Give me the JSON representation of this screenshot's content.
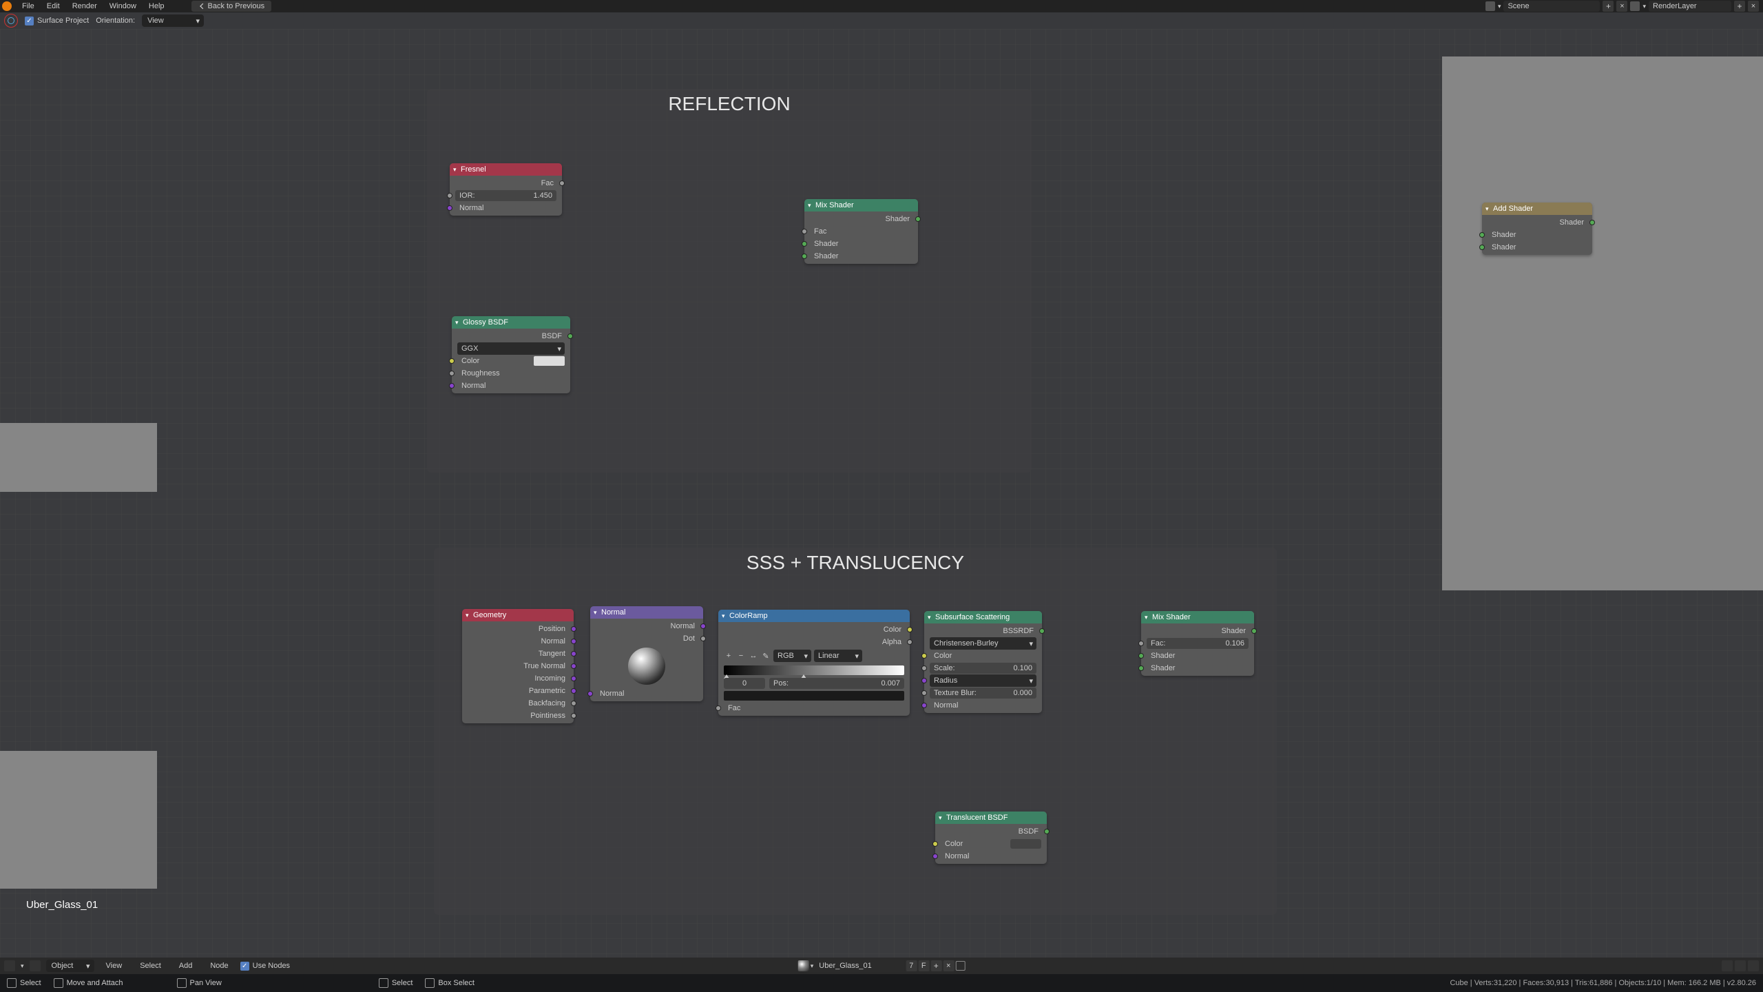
{
  "menu": {
    "file": "File",
    "edit": "Edit",
    "render": "Render",
    "window": "Window",
    "help": "Help",
    "back": "Back to Previous"
  },
  "header": {
    "scene": "Scene",
    "layer": "RenderLayer"
  },
  "subheader": {
    "surface_project": "Surface Project",
    "orientation": "Orientation:",
    "mode": "View"
  },
  "frames": {
    "reflection": "REFLECTION",
    "sss": "SSS + TRANSLUCENCY"
  },
  "nodes": {
    "fresnel": {
      "title": "Fresnel",
      "fac": "Fac",
      "ior_lbl": "IOR:",
      "ior_val": "1.450",
      "normal": "Normal"
    },
    "glossy": {
      "title": "Glossy BSDF",
      "bsdf": "BSDF",
      "dist": "GGX",
      "color": "Color",
      "rough": "Roughness",
      "normal": "Normal"
    },
    "mix1": {
      "title": "Mix Shader",
      "shader_out": "Shader",
      "fac": "Fac",
      "s1": "Shader",
      "s2": "Shader"
    },
    "addshader": {
      "title": "Add Shader",
      "shader_out": "Shader",
      "s1": "Shader",
      "s2": "Shader"
    },
    "geometry": {
      "title": "Geometry",
      "position": "Position",
      "normal": "Normal",
      "tangent": "Tangent",
      "true_normal": "True Normal",
      "incoming": "Incoming",
      "parametric": "Parametric",
      "backfacing": "Backfacing",
      "pointiness": "Pointiness"
    },
    "normalnode": {
      "title": "Normal",
      "normal_out": "Normal",
      "dot": "Dot",
      "normal_in": "Normal"
    },
    "colorramp": {
      "title": "ColorRamp",
      "color": "Color",
      "alpha": "Alpha",
      "mode1": "RGB",
      "mode2": "Linear",
      "pos_lbl": "Pos:",
      "pos_val": "0.007",
      "idx": "0",
      "fac": "Fac"
    },
    "sss": {
      "title": "Subsurface Scattering",
      "out": "BSSRDF",
      "method": "Christensen-Burley",
      "color": "Color",
      "scale_l": "Scale:",
      "scale_v": "0.100",
      "radius": "Radius",
      "blur_l": "Texture Blur:",
      "blur_v": "0.000",
      "normal": "Normal"
    },
    "mix2": {
      "title": "Mix Shader",
      "shader_out": "Shader",
      "fac_l": "Fac:",
      "fac_v": "0.106",
      "s1": "Shader",
      "s2": "Shader"
    },
    "translucent": {
      "title": "Translucent BSDF",
      "out": "BSDF",
      "color": "Color",
      "normal": "Normal"
    }
  },
  "material_label": "Uber_Glass_01",
  "bottombar": {
    "mode": "Object",
    "view": "View",
    "select": "Select",
    "add": "Add",
    "node": "Node",
    "use_nodes": "Use Nodes",
    "material": "Uber_Glass_01",
    "users": "7",
    "fake": "F"
  },
  "footer": {
    "select": "Select",
    "move": "Move and Attach",
    "pan": "Pan View",
    "select2": "Select",
    "box": "Box Select",
    "stats": "Cube | Verts:31,220 | Faces:30,913 | Tris:61,886 | Objects:1/10 | Mem: 166.2 MB | v2.80.26"
  }
}
